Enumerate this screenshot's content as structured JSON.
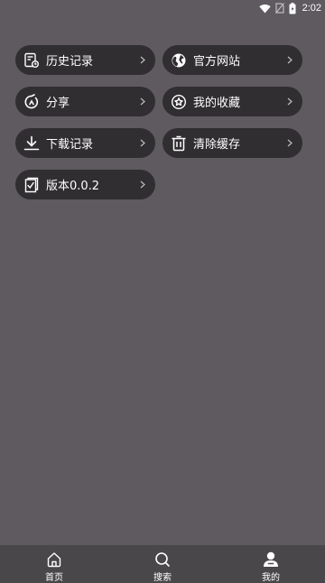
{
  "status_bar": {
    "time": "2:02",
    "icons": [
      "wifi-icon",
      "no-sim-icon",
      "battery-icon"
    ]
  },
  "menu": {
    "items": [
      {
        "label": "历史记录",
        "icon": "history-icon"
      },
      {
        "label": "官方网站",
        "icon": "globe-icon"
      },
      {
        "label": "分享",
        "icon": "share-icon"
      },
      {
        "label": "我的收藏",
        "icon": "star-icon"
      },
      {
        "label": "下载记录",
        "icon": "download-icon"
      },
      {
        "label": "清除缓存",
        "icon": "trash-icon"
      },
      {
        "label": "版本0.0.2",
        "icon": "version-icon"
      }
    ]
  },
  "bottom_nav": {
    "items": [
      {
        "label": "首页",
        "icon": "home-icon",
        "active": false
      },
      {
        "label": "搜索",
        "icon": "search-icon",
        "active": false
      },
      {
        "label": "我的",
        "icon": "profile-icon",
        "active": true
      }
    ]
  },
  "colors": {
    "background": "#5e5a5f",
    "menu_item_bg": "#302e31",
    "nav_bg": "#4a474b",
    "text": "#ffffff"
  }
}
